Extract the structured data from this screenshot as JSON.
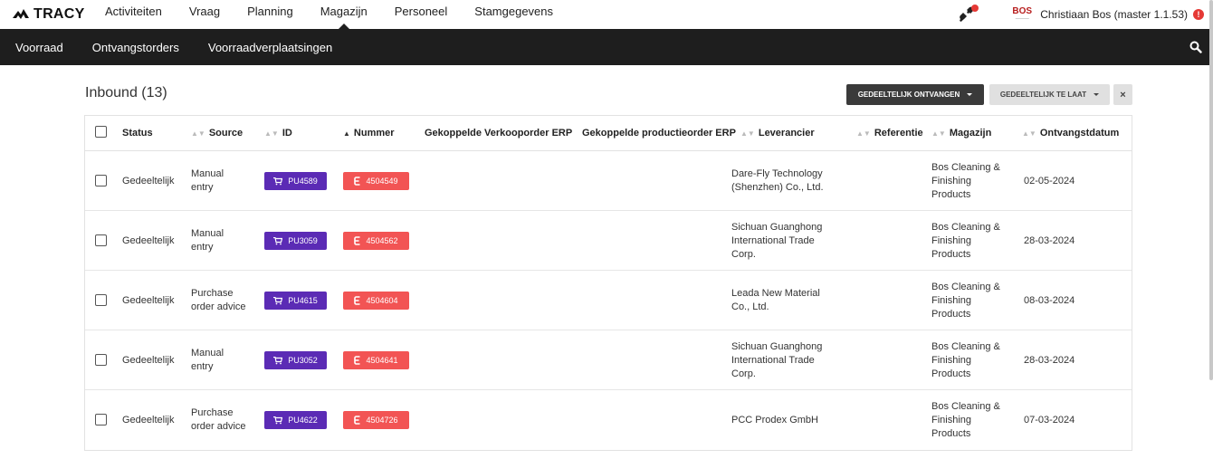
{
  "app": {
    "logo_text": "TRACY"
  },
  "main_menu": [
    {
      "label": "Activiteiten"
    },
    {
      "label": "Vraag"
    },
    {
      "label": "Planning"
    },
    {
      "label": "Magazijn",
      "active": true
    },
    {
      "label": "Personeel"
    },
    {
      "label": "Stamgegevens"
    }
  ],
  "user": {
    "logo_text": "BOS",
    "name": "Christiaan Bos (master 1.1.53)"
  },
  "sub_menu": [
    {
      "label": "Voorraad"
    },
    {
      "label": "Ontvangstorders"
    },
    {
      "label": "Voorraadverplaatsingen"
    }
  ],
  "page": {
    "title": "Inbound (13)",
    "filter_primary": "GEDEELTELIJK ONTVANGEN",
    "filter_secondary": "GEDEELTELIJK TE LAAT",
    "clear_label": "×"
  },
  "table": {
    "headers": {
      "status": "Status",
      "source": "Source",
      "id": "ID",
      "nummer": "Nummer",
      "verkooporder": "Gekoppelde Verkooporder ERP",
      "productieorder": "Gekoppelde productieorder ERP",
      "leverancier": "Leverancier",
      "referentie": "Referentie",
      "magazijn": "Magazijn",
      "ontvangstdatum": "Ontvangstdatum"
    },
    "rows": [
      {
        "status": "Gedeeltelijk",
        "source": [
          "Manual",
          "entry"
        ],
        "id": "PU4589",
        "nummer": "4504549",
        "leverancier": [
          "Dare-Fly Technology",
          "(Shenzhen) Co., Ltd."
        ],
        "magazijn": [
          "Bos Cleaning &",
          "Finishing",
          "Products"
        ],
        "datum": "02-05-2024"
      },
      {
        "status": "Gedeeltelijk",
        "source": [
          "Manual",
          "entry"
        ],
        "id": "PU3059",
        "nummer": "4504562",
        "leverancier": [
          "Sichuan Guanghong",
          "International Trade",
          "Corp."
        ],
        "magazijn": [
          "Bos Cleaning &",
          "Finishing",
          "Products"
        ],
        "datum": "28-03-2024"
      },
      {
        "status": "Gedeeltelijk",
        "source": [
          "Purchase",
          "order advice"
        ],
        "id": "PU4615",
        "nummer": "4504604",
        "leverancier": [
          "Leada New Material",
          "Co., Ltd."
        ],
        "magazijn": [
          "Bos Cleaning &",
          "Finishing",
          "Products"
        ],
        "datum": "08-03-2024"
      },
      {
        "status": "Gedeeltelijk",
        "source": [
          "Manual",
          "entry"
        ],
        "id": "PU3052",
        "nummer": "4504641",
        "leverancier": [
          "Sichuan Guanghong",
          "International Trade",
          "Corp."
        ],
        "magazijn": [
          "Bos Cleaning &",
          "Finishing",
          "Products"
        ],
        "datum": "28-03-2024"
      },
      {
        "status": "Gedeeltelijk",
        "source": [
          "Purchase",
          "order advice"
        ],
        "id": "PU4622",
        "nummer": "4504726",
        "leverancier": [
          "PCC Prodex GmbH"
        ],
        "magazijn": [
          "Bos Cleaning &",
          "Finishing",
          "Products"
        ],
        "datum": "07-03-2024"
      }
    ]
  },
  "colors": {
    "id_badge": "#5b2bb5",
    "nummer_badge": "#f25454",
    "subnav_bg": "#1e1e1e"
  }
}
